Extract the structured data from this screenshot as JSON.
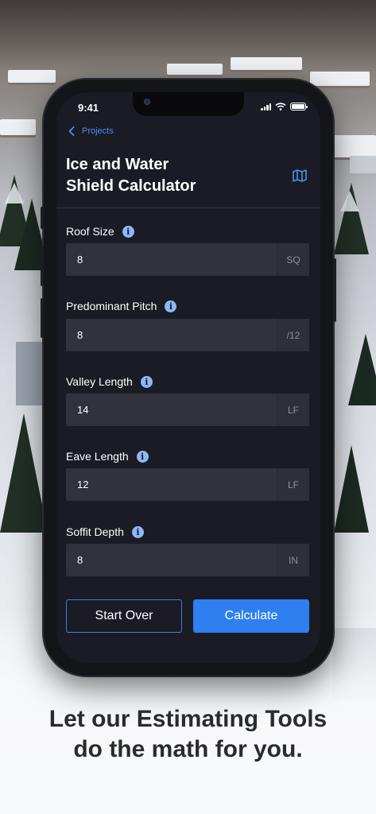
{
  "status_bar": {
    "time": "9:41"
  },
  "nav": {
    "back_label": "Projects"
  },
  "page": {
    "title_line1": "Ice and Water",
    "title_line2": "Shield Calculator"
  },
  "fields": [
    {
      "label": "Roof Size",
      "value": "8",
      "unit": "SQ"
    },
    {
      "label": "Predominant Pitch",
      "value": "8",
      "unit": "/12"
    },
    {
      "label": "Valley Length",
      "value": "14",
      "unit": "LF"
    },
    {
      "label": "Eave Length",
      "value": "12",
      "unit": "LF"
    },
    {
      "label": "Soffit Depth",
      "value": "8",
      "unit": "IN"
    }
  ],
  "actions": {
    "start_over": "Start Over",
    "calculate": "Calculate"
  },
  "caption": {
    "line1": "Let our Estimating Tools",
    "line2": "do the math for you."
  },
  "icons": {
    "back": "chevron-left-icon",
    "map": "map-icon",
    "info": "info-icon"
  },
  "colors": {
    "accent": "#2e7ff0",
    "screen_bg": "#1a1b24",
    "field_bg": "#31323d",
    "info": "#8db8f7"
  }
}
